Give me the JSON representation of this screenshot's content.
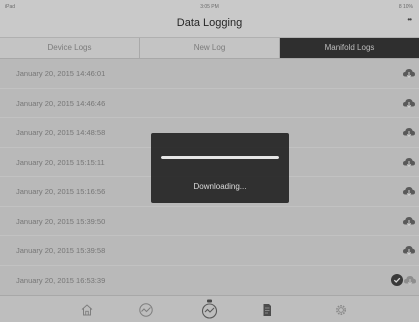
{
  "status_bar": {
    "device": "iPad",
    "time": "3:05 PM",
    "battery": "8 10%"
  },
  "nav": {
    "title": "Data Logging",
    "more_label": "••"
  },
  "tabs": [
    {
      "label": "Device Logs",
      "active": false
    },
    {
      "label": "New Log",
      "active": false
    },
    {
      "label": "Manifold Logs",
      "active": true
    }
  ],
  "logs": [
    {
      "date": "January 20, 2015 14:46:01"
    },
    {
      "date": "January 20, 2015 14:46:46"
    },
    {
      "date": "January 20, 2015 14:48:58"
    },
    {
      "date": "January 20, 2015 15:15:11"
    },
    {
      "date": "January 20, 2015 15:16:56"
    },
    {
      "date": "January 20, 2015 15:39:50"
    },
    {
      "date": "January 20, 2015 15:39:58"
    },
    {
      "date": "January 20, 2015 16:53:39",
      "selected": true
    }
  ],
  "overlay": {
    "message": "Downloading...",
    "progress": 1.0
  },
  "tab_bar": [
    {
      "icon": "home-icon"
    },
    {
      "icon": "gauge-icon"
    },
    {
      "icon": "data-logging-icon",
      "active": true
    },
    {
      "icon": "document-icon"
    },
    {
      "icon": "gear-icon"
    }
  ],
  "colors": {
    "active_tab": "#2f2f2f",
    "overlay": "#262626",
    "background": "#b9b9b9"
  }
}
